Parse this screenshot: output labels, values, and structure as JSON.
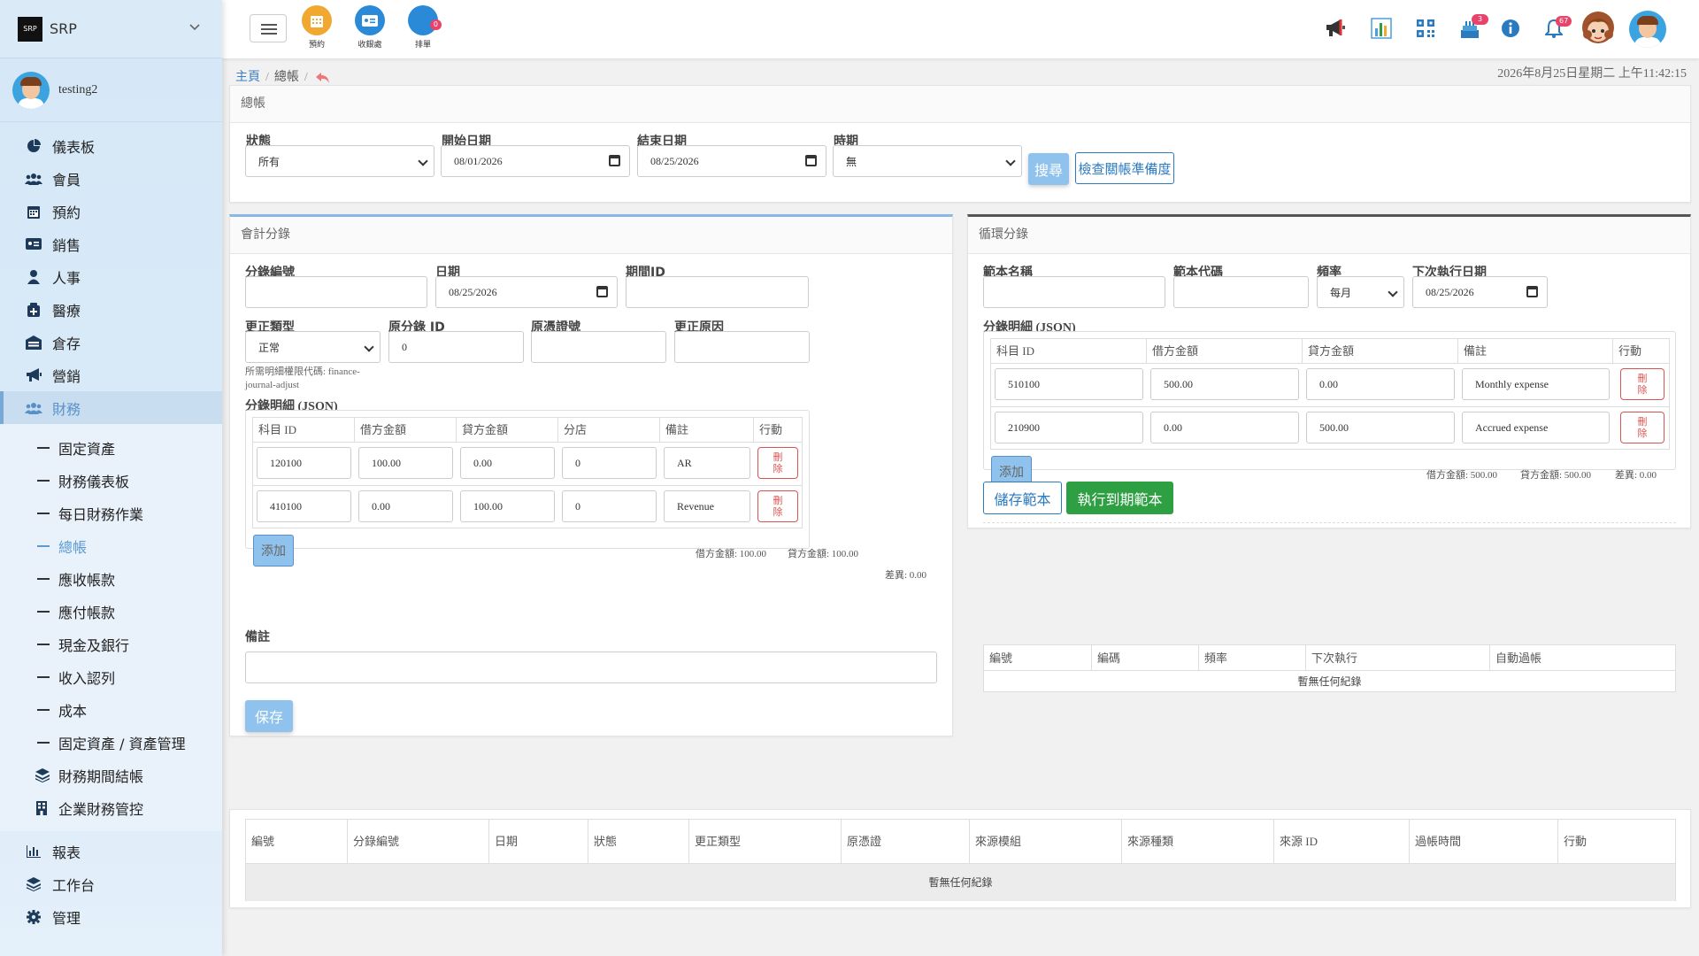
{
  "brand": {
    "name": "SRP",
    "logo_text": "SRP"
  },
  "user": {
    "name": "testing2"
  },
  "sidebar": {
    "items": [
      {
        "label": "儀表板",
        "icon": "pie-chart-icon"
      },
      {
        "label": "會員",
        "icon": "users-icon"
      },
      {
        "label": "預約",
        "icon": "calendar-icon"
      },
      {
        "label": "銷售",
        "icon": "id-card-icon"
      },
      {
        "label": "人事",
        "icon": "user-icon"
      },
      {
        "label": "醫療",
        "icon": "medical-icon"
      },
      {
        "label": "倉存",
        "icon": "warehouse-icon"
      },
      {
        "label": "營銷",
        "icon": "megaphone-icon"
      },
      {
        "label": "財務",
        "icon": "finance-users-icon"
      }
    ],
    "finance_sub": [
      "固定資產",
      "財務儀表板",
      "每日財務作業",
      "總帳",
      "應收帳款",
      "應付帳款",
      "現金及銀行",
      "收入認列",
      "成本",
      "固定資產 / 資產管理"
    ],
    "finance_groups": [
      {
        "label": "財務期間結帳",
        "icon": "layers-icon"
      },
      {
        "label": "企業財務管控",
        "icon": "building-icon"
      }
    ],
    "bottom_items": [
      {
        "label": "報表",
        "icon": "bar-chart-icon"
      },
      {
        "label": "工作台",
        "icon": "layers-icon"
      },
      {
        "label": "管理",
        "icon": "gear-icon"
      }
    ]
  },
  "topbar": {
    "quick": [
      {
        "label": "預約",
        "color": "#f0a830"
      },
      {
        "label": "收銀處",
        "color": "#2a8ad8"
      },
      {
        "label": "排單",
        "color": "#2a8ad8",
        "badge": "0"
      }
    ],
    "notif_badge_1": "3",
    "notif_badge_2": "67"
  },
  "breadcrumb": {
    "home": "主頁",
    "current": "總帳"
  },
  "datetime": "2026年8月25日星期二 上午11:42:15",
  "filter": {
    "title": "總帳",
    "status_label": "狀態",
    "status_value": "所有",
    "start_label": "開始日期",
    "start_value": "08/01/2026",
    "end_label": "結束日期",
    "end_value": "08/25/2026",
    "period_label": "時期",
    "period_value": "無",
    "search_btn": "搜尋",
    "check_btn": "檢查關帳準備度"
  },
  "journal": {
    "title": "會計分錄",
    "no_label": "分錄編號",
    "no_value": "",
    "date_label": "日期",
    "date_value": "08/25/2026",
    "period_id_label": "期間ID",
    "period_id_value": "",
    "corr_type_label": "更正類型",
    "corr_type_value": "正常",
    "orig_id_label": "原分錄 ID",
    "orig_id_value": "0",
    "orig_voucher_label": "原憑證號",
    "orig_voucher_value": "",
    "corr_reason_label": "更正原因",
    "corr_reason_value": "",
    "perm_hint": "所需明細權限代碼: finance-journal-adjust",
    "lines_label": "分錄明細 (JSON)",
    "headers": [
      "科目 ID",
      "借方金額",
      "貸方金額",
      "分店",
      "備註",
      "行動"
    ],
    "rows": [
      {
        "account": "120100",
        "debit": "100.00",
        "credit": "0.00",
        "branch": "0",
        "note": "AR"
      },
      {
        "account": "410100",
        "debit": "0.00",
        "credit": "100.00",
        "branch": "0",
        "note": "Revenue"
      }
    ],
    "delete_btn": "刪除",
    "add_btn": "添加",
    "sum_debit": "借方金額: 100.00",
    "sum_credit": "貸方金額: 100.00",
    "sum_diff": "差異: 0.00",
    "remark_label": "備註",
    "remark_value": "",
    "save_btn": "保存"
  },
  "recurring": {
    "title": "循環分錄",
    "tpl_name_label": "範本名稱",
    "tpl_name_value": "",
    "tpl_code_label": "範本代碼",
    "tpl_code_value": "",
    "freq_label": "頻率",
    "freq_value": "每月",
    "next_date_label": "下次執行日期",
    "next_date_value": "08/25/2026",
    "lines_label": "分錄明細 (JSON)",
    "headers": [
      "科目 ID",
      "借方金額",
      "貸方金額",
      "備註",
      "行動"
    ],
    "rows": [
      {
        "account": "510100",
        "debit": "500.00",
        "credit": "0.00",
        "note": "Monthly expense"
      },
      {
        "account": "210900",
        "debit": "0.00",
        "credit": "500.00",
        "note": "Accrued expense"
      }
    ],
    "delete_btn": "刪除",
    "add_btn": "添加",
    "sum_debit": "借方金額: 500.00",
    "sum_credit": "貸方金額: 500.00",
    "sum_diff": "差異: 0.00",
    "save_tpl_btn": "儲存範本",
    "run_due_btn": "執行到期範本",
    "list_headers": [
      "編號",
      "編碼",
      "頻率",
      "下次執行",
      "自動過帳"
    ],
    "empty": "暫無任何紀錄"
  },
  "entries": {
    "headers": [
      "編號",
      "分錄編號",
      "日期",
      "狀態",
      "更正類型",
      "原憑證",
      "來源模組",
      "來源種類",
      "來源 ID",
      "過帳時間",
      "行動"
    ],
    "empty": "暫無任何紀錄"
  }
}
